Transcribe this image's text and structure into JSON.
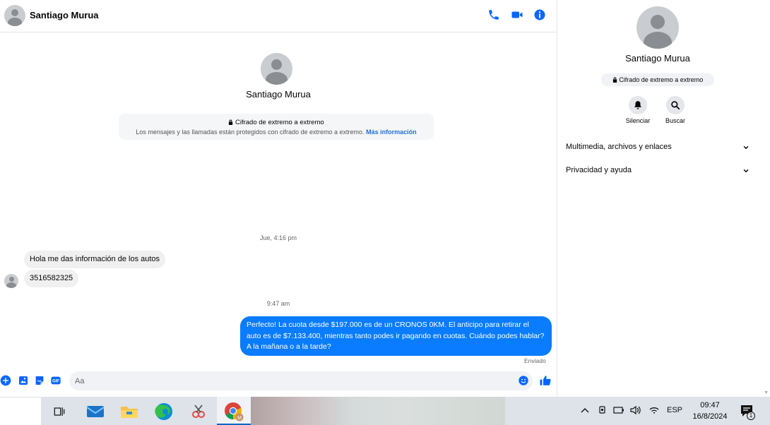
{
  "header": {
    "contact_name": "Santiago Murua",
    "icons": [
      "phone-icon",
      "video-camera-icon",
      "info-icon"
    ]
  },
  "intro": {
    "contact_name": "Santiago Murua",
    "e2e_title": "Cifrado de extremo a extremo",
    "e2e_text": "Los mensajes y las llamadas están protegidos con cifrado de extremo a extremo.",
    "e2e_link": "Más información"
  },
  "messages": {
    "timestamp_1": "Jue, 4:16 pm",
    "incoming_1": "Hola me das información de los autos",
    "incoming_2": "3516582325",
    "timestamp_2": "9:47 am",
    "outgoing_1": "Perfecto! La cuota desde $197.000 es de un CRONOS 0KM. El anticipo para retirar el auto es de $7.133.400, mientras tanto podes ir pagando en cuotas. Cuándo podes hablar? A la mañana o a la tarde?",
    "outgoing_status": "Enviado"
  },
  "composer": {
    "placeholder": "Aa"
  },
  "info_panel": {
    "contact_name": "Santiago Murua",
    "e2e_badge": "Cifrado de extremo a extremo",
    "actions": [
      {
        "label": "Silenciar",
        "icon": "bell-icon"
      },
      {
        "label": "Buscar",
        "icon": "search-icon"
      }
    ],
    "sections": [
      {
        "label": "Multimedia, archivos y enlaces"
      },
      {
        "label": "Privacidad y ayuda"
      }
    ]
  },
  "taskbar": {
    "language": "ESP",
    "time": "09:47",
    "date": "16/8/2024",
    "notification_count": "1"
  },
  "colors": {
    "accent": "#0a7cff",
    "icon_blue": "#0866ff",
    "link": "#216fdb"
  }
}
